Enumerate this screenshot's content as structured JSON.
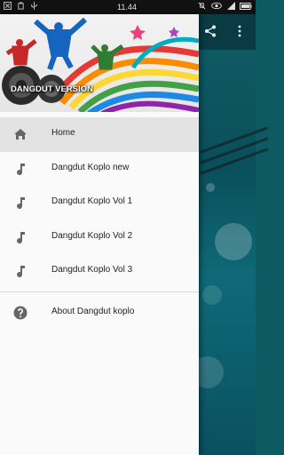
{
  "status_bar": {
    "time": "11.44",
    "left_icons": [
      "close-box-icon",
      "usb-icon",
      "usb-trident-icon"
    ],
    "right_icons": [
      "mute-icon",
      "eye-icon",
      "signal-icon",
      "battery-icon"
    ]
  },
  "drawer": {
    "header_title": "DANGDUT VERSION",
    "items": [
      {
        "label": "Home",
        "icon": "home-icon",
        "active": true
      },
      {
        "label": "Dangdut Koplo new",
        "icon": "music-note-icon"
      },
      {
        "label": "Dangdut Koplo Vol 1",
        "icon": "music-note-icon"
      },
      {
        "label": "Dangdut Koplo Vol 2",
        "icon": "music-note-icon"
      },
      {
        "label": "Dangdut Koplo Vol 3",
        "icon": "music-note-icon"
      }
    ],
    "footer_items": [
      {
        "label": "About Dangdut koplo",
        "icon": "help-circle-icon"
      }
    ]
  },
  "app_bar_icons": [
    "share-icon",
    "overflow-menu-icon"
  ],
  "colors": {
    "accent": "#0a3b44",
    "drawer_bg": "#fafafa",
    "active_item_bg": "#e3e3e3",
    "icon_gray": "#666666"
  }
}
